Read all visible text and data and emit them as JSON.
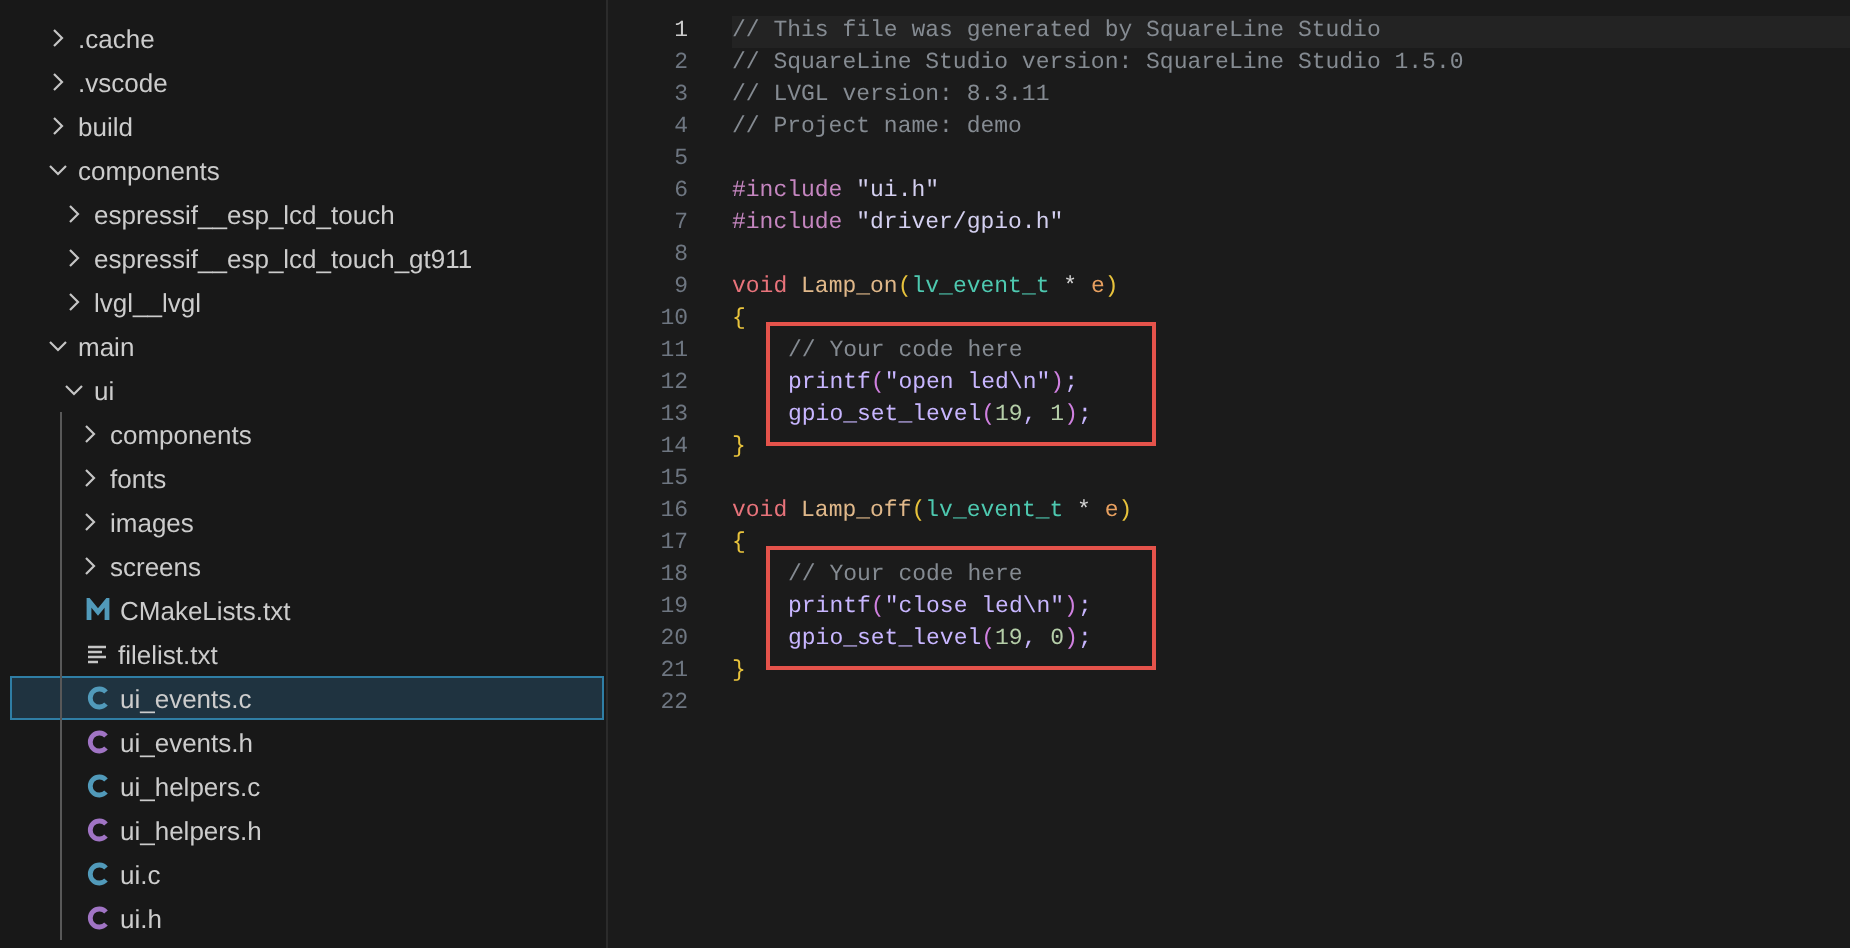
{
  "explorer": {
    "tree": [
      {
        "label": ".cache",
        "kind": "folder",
        "expanded": false,
        "selected": false
      },
      {
        "label": ".vscode",
        "kind": "folder",
        "expanded": false,
        "selected": false
      },
      {
        "label": "build",
        "kind": "folder",
        "expanded": false,
        "selected": false
      },
      {
        "label": "components",
        "kind": "folder",
        "expanded": true,
        "selected": false,
        "children": [
          {
            "label": "espressif__esp_lcd_touch",
            "kind": "folder",
            "expanded": false,
            "selected": false
          },
          {
            "label": "espressif__esp_lcd_touch_gt911",
            "kind": "folder",
            "expanded": false,
            "selected": false
          },
          {
            "label": "lvgl__lvgl",
            "kind": "folder",
            "expanded": false,
            "selected": false
          }
        ]
      },
      {
        "label": "main",
        "kind": "folder",
        "expanded": true,
        "selected": false,
        "children": [
          {
            "label": "ui",
            "kind": "folder",
            "expanded": true,
            "selected": false,
            "children": [
              {
                "label": "components",
                "kind": "folder",
                "expanded": false,
                "selected": false
              },
              {
                "label": "fonts",
                "kind": "folder",
                "expanded": false,
                "selected": false
              },
              {
                "label": "images",
                "kind": "folder",
                "expanded": false,
                "selected": false
              },
              {
                "label": "screens",
                "kind": "folder",
                "expanded": false,
                "selected": false
              },
              {
                "label": "CMakeLists.txt",
                "kind": "cmake",
                "selected": false
              },
              {
                "label": "filelist.txt",
                "kind": "text",
                "selected": false
              },
              {
                "label": "ui_events.c",
                "kind": "c-source",
                "selected": true
              },
              {
                "label": "ui_events.h",
                "kind": "c-header",
                "selected": false
              },
              {
                "label": "ui_helpers.c",
                "kind": "c-source",
                "selected": false
              },
              {
                "label": "ui_helpers.h",
                "kind": "c-header",
                "selected": false
              },
              {
                "label": "ui.c",
                "kind": "c-source",
                "selected": false
              },
              {
                "label": "ui.h",
                "kind": "c-header",
                "selected": false
              }
            ]
          }
        ]
      }
    ]
  },
  "editor": {
    "lines": [
      {
        "number": "1",
        "current": true,
        "boxed": false,
        "tokens": [
          {
            "kind": "comment",
            "text": "// This file was generated by SquareLine Studio"
          }
        ]
      },
      {
        "number": "2",
        "current": false,
        "boxed": false,
        "tokens": [
          {
            "kind": "comment",
            "text": "// SquareLine Studio version: SquareLine Studio 1.5.0"
          }
        ]
      },
      {
        "number": "3",
        "current": false,
        "boxed": false,
        "tokens": [
          {
            "kind": "comment",
            "text": "// LVGL version: 8.3.11"
          }
        ]
      },
      {
        "number": "4",
        "current": false,
        "boxed": false,
        "tokens": [
          {
            "kind": "comment",
            "text": "// Project name: demo"
          }
        ]
      },
      {
        "number": "5",
        "current": false,
        "boxed": false
      },
      {
        "number": "6",
        "current": false,
        "boxed": false,
        "tokens": [
          {
            "kind": "directive",
            "text": "#include"
          },
          {
            "kind": "string",
            "text": " \"ui.h\""
          }
        ]
      },
      {
        "number": "7",
        "current": false,
        "boxed": false,
        "tokens": [
          {
            "kind": "directive",
            "text": "#include"
          },
          {
            "kind": "string",
            "text": " \"driver/gpio.h\""
          }
        ]
      },
      {
        "number": "8",
        "current": false,
        "boxed": false
      },
      {
        "number": "9",
        "current": false,
        "boxed": false,
        "tokens": [
          {
            "kind": "keyword",
            "text": "void"
          },
          {
            "kind": "function",
            "text": " Lamp_on"
          },
          {
            "kind": "bracket",
            "text": "("
          },
          {
            "kind": "type",
            "text": "lv_event_t"
          },
          {
            "kind": "plain",
            "text": " * "
          },
          {
            "kind": "param",
            "text": "e"
          },
          {
            "kind": "bracket",
            "text": ")"
          }
        ]
      },
      {
        "number": "10",
        "current": false,
        "boxed": false,
        "tokens": [
          {
            "kind": "brace",
            "text": "{"
          }
        ]
      },
      {
        "number": "11",
        "current": false,
        "boxed": true,
        "tokens": [
          {
            "kind": "comment",
            "text": "// Your code here"
          }
        ]
      },
      {
        "number": "12",
        "current": false,
        "boxed": true,
        "tokens": [
          {
            "kind": "call",
            "text": "printf"
          },
          {
            "kind": "bracket2",
            "text": "("
          },
          {
            "kind": "call",
            "text": "\"open led\\n\""
          },
          {
            "kind": "bracket2",
            "text": ")"
          },
          {
            "kind": "call",
            "text": ";"
          }
        ]
      },
      {
        "number": "13",
        "current": false,
        "boxed": true,
        "tokens": [
          {
            "kind": "call",
            "text": "gpio_set_level"
          },
          {
            "kind": "bracket2",
            "text": "("
          },
          {
            "kind": "number",
            "text": "19"
          },
          {
            "kind": "call",
            "text": ", "
          },
          {
            "kind": "number",
            "text": "1"
          },
          {
            "kind": "bracket2",
            "text": ")"
          },
          {
            "kind": "call",
            "text": ";"
          }
        ]
      },
      {
        "number": "14",
        "current": false,
        "boxed": false,
        "tokens": [
          {
            "kind": "brace",
            "text": "}"
          }
        ]
      },
      {
        "number": "15",
        "current": false,
        "boxed": false
      },
      {
        "number": "16",
        "current": false,
        "boxed": false,
        "tokens": [
          {
            "kind": "keyword",
            "text": "void"
          },
          {
            "kind": "function",
            "text": " Lamp_off"
          },
          {
            "kind": "bracket",
            "text": "("
          },
          {
            "kind": "type",
            "text": "lv_event_t"
          },
          {
            "kind": "plain",
            "text": " * "
          },
          {
            "kind": "param",
            "text": "e"
          },
          {
            "kind": "bracket",
            "text": ")"
          }
        ]
      },
      {
        "number": "17",
        "current": false,
        "boxed": false,
        "tokens": [
          {
            "kind": "brace",
            "text": "{"
          }
        ]
      },
      {
        "number": "18",
        "current": false,
        "boxed": true,
        "tokens": [
          {
            "kind": "comment",
            "text": "// Your code here"
          }
        ]
      },
      {
        "number": "19",
        "current": false,
        "boxed": true,
        "tokens": [
          {
            "kind": "call",
            "text": "printf"
          },
          {
            "kind": "bracket2",
            "text": "("
          },
          {
            "kind": "call",
            "text": "\"close led\\n\""
          },
          {
            "kind": "bracket2",
            "text": ")"
          },
          {
            "kind": "call",
            "text": ";"
          }
        ]
      },
      {
        "number": "20",
        "current": false,
        "boxed": true,
        "tokens": [
          {
            "kind": "call",
            "text": "gpio_set_level"
          },
          {
            "kind": "bracket2",
            "text": "("
          },
          {
            "kind": "number",
            "text": "19"
          },
          {
            "kind": "call",
            "text": ", "
          },
          {
            "kind": "number",
            "text": "0"
          },
          {
            "kind": "bracket2",
            "text": ")"
          },
          {
            "kind": "call",
            "text": ";"
          }
        ]
      },
      {
        "number": "21",
        "current": false,
        "boxed": false,
        "tokens": [
          {
            "kind": "brace",
            "text": "}"
          }
        ]
      },
      {
        "number": "22",
        "current": false,
        "boxed": false
      }
    ]
  }
}
